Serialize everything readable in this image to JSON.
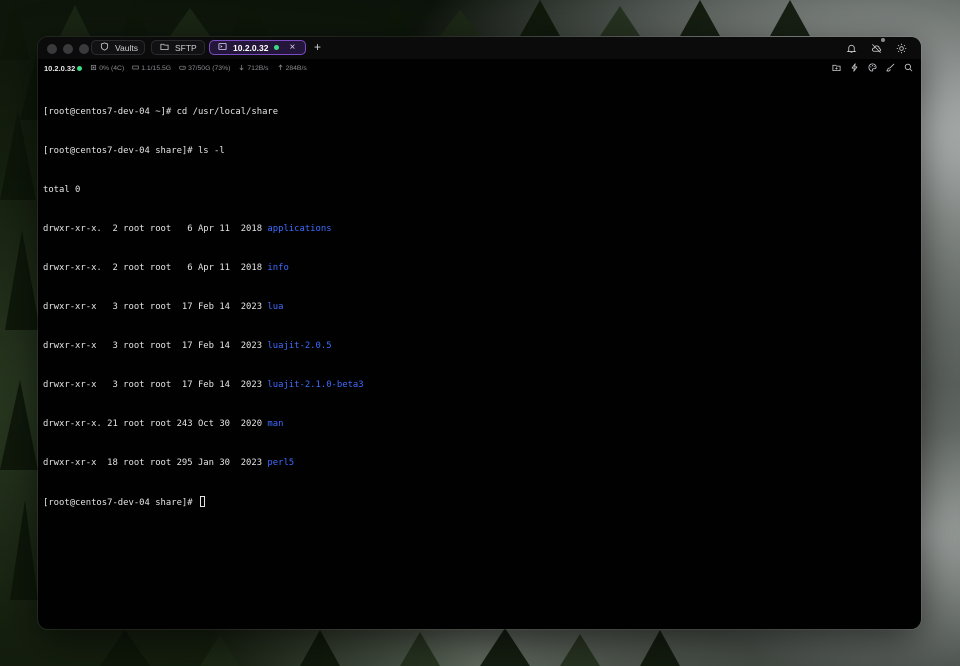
{
  "tabs": [
    {
      "label": "Vaults",
      "icon": "shield-icon"
    },
    {
      "label": "SFTP",
      "icon": "folder-icon"
    },
    {
      "label": "10.2.0.32",
      "icon": "terminal-icon",
      "active": true,
      "status_color": "#3ddc84"
    }
  ],
  "new_tab_label": "+",
  "close_label": "×",
  "titlebar_icons": [
    "bell-icon",
    "cloud-off-icon",
    "sun-icon"
  ],
  "status": {
    "host": "10.2.0.32",
    "cpu": "0% (4C)",
    "memory": "1.1/15.5G",
    "disk": "37/50G (73%)",
    "download": "712B/s",
    "upload": "284B/s"
  },
  "status_icons": [
    "new-folder-icon",
    "lightning-icon",
    "palette-icon",
    "brush-icon",
    "search-icon"
  ],
  "colors": {
    "accent": "#7a4cc4",
    "online": "#3ddc84",
    "directory": "#3f6bff"
  },
  "terminal": {
    "lines": [
      {
        "prompt": "[root@centos7-dev-04 ~]# ",
        "command": "cd /usr/local/share"
      },
      {
        "prompt": "[root@centos7-dev-04 share]# ",
        "command": "ls -l"
      },
      {
        "text": "total 0"
      },
      {
        "meta": "drwxr-xr-x.  2 root root   6 Apr 11  2018 ",
        "name": "applications"
      },
      {
        "meta": "drwxr-xr-x.  2 root root   6 Apr 11  2018 ",
        "name": "info"
      },
      {
        "meta": "drwxr-xr-x   3 root root  17 Feb 14  2023 ",
        "name": "lua"
      },
      {
        "meta": "drwxr-xr-x   3 root root  17 Feb 14  2023 ",
        "name": "luajit-2.0.5"
      },
      {
        "meta": "drwxr-xr-x   3 root root  17 Feb 14  2023 ",
        "name": "luajit-2.1.0-beta3"
      },
      {
        "meta": "drwxr-xr-x. 21 root root 243 Oct 30  2020 ",
        "name": "man"
      },
      {
        "meta": "drwxr-xr-x  18 root root 295 Jan 30  2023 ",
        "name": "perl5"
      }
    ],
    "current_prompt": "[root@centos7-dev-04 share]# "
  }
}
